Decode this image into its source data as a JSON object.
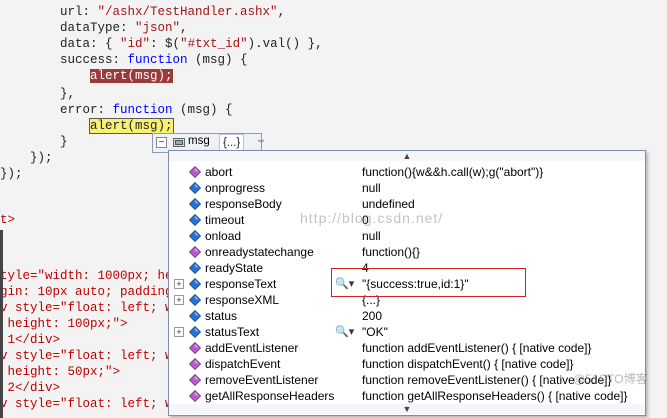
{
  "editor": {
    "lines": [
      {
        "pre": "        url: ",
        "str": "\"/ashx/TestHandler.ashx\"",
        "post": ","
      },
      {
        "pre": "        dataType: ",
        "str": "\"json\"",
        "post": ","
      },
      {
        "pre": "        data: { ",
        "str": "\"id\"",
        "mid": ": $(",
        "str2": "\"#txt_id\"",
        "post": ").val() },"
      },
      {
        "pre": "        success: ",
        "kw": "function",
        "post": " (msg) {"
      },
      {
        "pre": "            ",
        "bp": "alert(msg);"
      },
      {
        "pre": "        },"
      },
      {
        "pre": "        error: ",
        "kw": "function",
        "post": " (msg) {"
      },
      {
        "pre": "            ",
        "cur": "alert(msg);"
      },
      {
        "pre": "        }"
      },
      {
        "pre": "    });"
      },
      {
        "pre": "});"
      }
    ],
    "left_lines": [
      "t>",
      "tyle=\"width: 1000px; hei",
      "gin: 10px auto; padding",
      "v style=\"float: left; wi",
      " height: 100px;\">",
      " 1</div>",
      "v style=\"float: left; wi",
      " height: 50px;\">",
      " 2</div>",
      "v style=\"float: left; wi"
    ]
  },
  "datatip": {
    "header": {
      "name": "msg",
      "value": "{...}"
    },
    "rows": [
      {
        "name": "abort",
        "value": "function(){w&&h.call(w);g(\"abort\")}",
        "icon": "method-icon",
        "expand": false,
        "mag": false
      },
      {
        "name": "onprogress",
        "value": "null",
        "icon": "property-icon",
        "expand": false,
        "mag": false
      },
      {
        "name": "responseBody",
        "value": "undefined",
        "icon": "property-icon",
        "expand": false,
        "mag": false
      },
      {
        "name": "timeout",
        "value": "0",
        "icon": "property-icon",
        "expand": false,
        "mag": false
      },
      {
        "name": "onload",
        "value": "null",
        "icon": "property-icon",
        "expand": false,
        "mag": false
      },
      {
        "name": "onreadystatechange",
        "value": "function(){}",
        "icon": "method-icon",
        "expand": false,
        "mag": false
      },
      {
        "name": "readyState",
        "value": "4",
        "icon": "property-icon",
        "expand": false,
        "mag": false
      },
      {
        "name": "responseText",
        "value": "\"{success:true,id:1}\"",
        "icon": "property-icon",
        "expand": true,
        "mag": true
      },
      {
        "name": "responseXML",
        "value": "{...}",
        "icon": "property-icon",
        "expand": true,
        "mag": false
      },
      {
        "name": "status",
        "value": "200",
        "icon": "property-icon",
        "expand": false,
        "mag": false
      },
      {
        "name": "statusText",
        "value": "\"OK\"",
        "icon": "property-icon",
        "expand": true,
        "mag": true
      },
      {
        "name": "addEventListener",
        "value": "function addEventListener() {    [native code]}",
        "icon": "method-icon",
        "expand": false,
        "mag": false
      },
      {
        "name": "dispatchEvent",
        "value": "function dispatchEvent() {    [native code]}",
        "icon": "method-icon",
        "expand": false,
        "mag": false
      },
      {
        "name": "removeEventListener",
        "value": "function removeEventListener() {    [native code]}",
        "icon": "method-icon",
        "expand": false,
        "mag": false
      },
      {
        "name": "getAllResponseHeaders",
        "value": "function getAllResponseHeaders() {    [native code]}",
        "icon": "method-icon",
        "expand": false,
        "mag": false
      }
    ]
  },
  "watermark": "http://blog.csdn.net/",
  "watermark2": "@51CTO博客",
  "colors": {
    "method": "#b45fc6",
    "property": "#2a6fd6",
    "highlight_box": "#d02020",
    "breakpoint": "#9b3a3a",
    "current": "#f7f070"
  }
}
